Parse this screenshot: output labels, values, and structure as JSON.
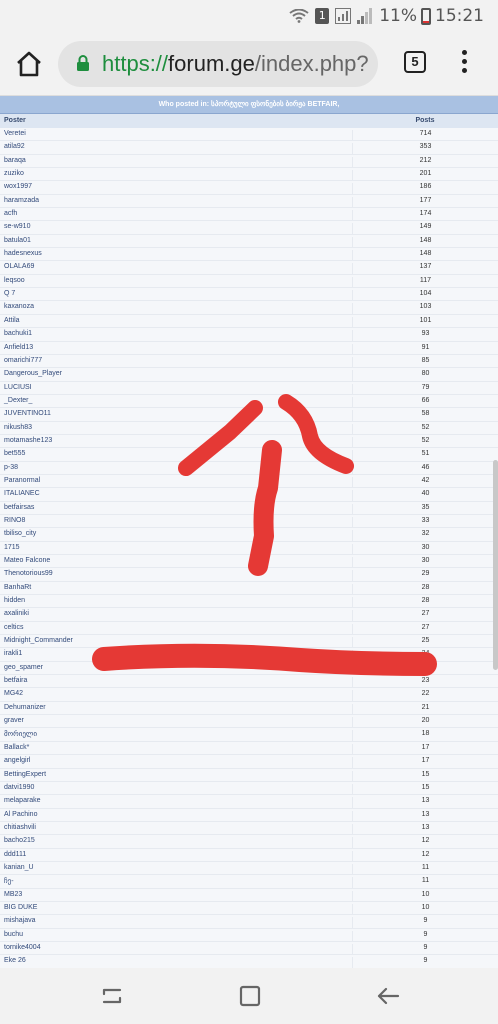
{
  "status_bar": {
    "sim_label": "1",
    "battery": "11%",
    "time": "15:21"
  },
  "browser": {
    "url_scheme": "https://",
    "url_host": "forum.ge",
    "url_path": "/index.php?",
    "tab_count": "5"
  },
  "table": {
    "title": "Who posted in: სპორტული ფსონების ბირჟა BETFAIR,",
    "header_poster": "Poster",
    "header_posts": "Posts",
    "rows": [
      {
        "poster": "Veretei",
        "posts": "714"
      },
      {
        "poster": "atila92",
        "posts": "353"
      },
      {
        "poster": "baraqa",
        "posts": "212"
      },
      {
        "poster": "zuziko",
        "posts": "201"
      },
      {
        "poster": "wox1997",
        "posts": "186"
      },
      {
        "poster": "haramzada",
        "posts": "177"
      },
      {
        "poster": "acfh",
        "posts": "174"
      },
      {
        "poster": "se-w910",
        "posts": "149"
      },
      {
        "poster": "batula01",
        "posts": "148"
      },
      {
        "poster": "hadesnexus",
        "posts": "148"
      },
      {
        "poster": "OLALA69",
        "posts": "137"
      },
      {
        "poster": "leqsoo",
        "posts": "117"
      },
      {
        "poster": "Q 7",
        "posts": "104"
      },
      {
        "poster": "kaxanoza",
        "posts": "103"
      },
      {
        "poster": "Attila",
        "posts": "101"
      },
      {
        "poster": "bachuki1",
        "posts": "93"
      },
      {
        "poster": "Anfield13",
        "posts": "91"
      },
      {
        "poster": "omarichi777",
        "posts": "85"
      },
      {
        "poster": "Dangerous_Player",
        "posts": "80"
      },
      {
        "poster": "LUCIUSI",
        "posts": "79"
      },
      {
        "poster": "_Dexter_",
        "posts": "66"
      },
      {
        "poster": "JUVENTINO11",
        "posts": "58"
      },
      {
        "poster": "nikush83",
        "posts": "52"
      },
      {
        "poster": "motamashe123",
        "posts": "52"
      },
      {
        "poster": "bet555",
        "posts": "51"
      },
      {
        "poster": "p-38",
        "posts": "46"
      },
      {
        "poster": "Paranormal",
        "posts": "42"
      },
      {
        "poster": "ITALIANEC",
        "posts": "40"
      },
      {
        "poster": "betfairsas",
        "posts": "35"
      },
      {
        "poster": "RINO8",
        "posts": "33"
      },
      {
        "poster": "tbiliso_city",
        "posts": "32"
      },
      {
        "poster": "1715",
        "posts": "30"
      },
      {
        "poster": "Mateo Falcone",
        "posts": "30"
      },
      {
        "poster": "Thenotorious99",
        "posts": "29"
      },
      {
        "poster": "BanhaRt",
        "posts": "28"
      },
      {
        "poster": "hidden",
        "posts": "28"
      },
      {
        "poster": "axaliniki",
        "posts": "27"
      },
      {
        "poster": "celtics",
        "posts": "27"
      },
      {
        "poster": "Midnight_Commander",
        "posts": "25"
      },
      {
        "poster": "irakli1",
        "posts": "24"
      },
      {
        "poster": "geo_spamer",
        "posts": "24"
      },
      {
        "poster": "betfaira",
        "posts": "23"
      },
      {
        "poster": "MG42",
        "posts": "22"
      },
      {
        "poster": "Dehumanizer",
        "posts": "21"
      },
      {
        "poster": "graver",
        "posts": "20"
      },
      {
        "poster": "მორიელი",
        "posts": "18"
      },
      {
        "poster": "Ballack*",
        "posts": "17"
      },
      {
        "poster": "angelgirl",
        "posts": "17"
      },
      {
        "poster": "BettingExpert",
        "posts": "15"
      },
      {
        "poster": "datvi1990",
        "posts": "15"
      },
      {
        "poster": "melaparake",
        "posts": "13"
      },
      {
        "poster": "Al Pachino",
        "posts": "13"
      },
      {
        "poster": "chitiashvili",
        "posts": "13"
      },
      {
        "poster": "bacho215",
        "posts": "12"
      },
      {
        "poster": "ddd111",
        "posts": "12"
      },
      {
        "poster": "kanian_U",
        "posts": "11"
      },
      {
        "poster": "ჩე-",
        "posts": "11"
      },
      {
        "poster": "MB23",
        "posts": "10"
      },
      {
        "poster": "BIG DUKE",
        "posts": "10"
      },
      {
        "poster": "mishajava",
        "posts": "9"
      },
      {
        "poster": "buchu",
        "posts": "9"
      },
      {
        "poster": "tornike4004",
        "posts": "9"
      },
      {
        "poster": "Eke 26",
        "posts": "9"
      }
    ]
  },
  "annotation_color": "#e53935"
}
